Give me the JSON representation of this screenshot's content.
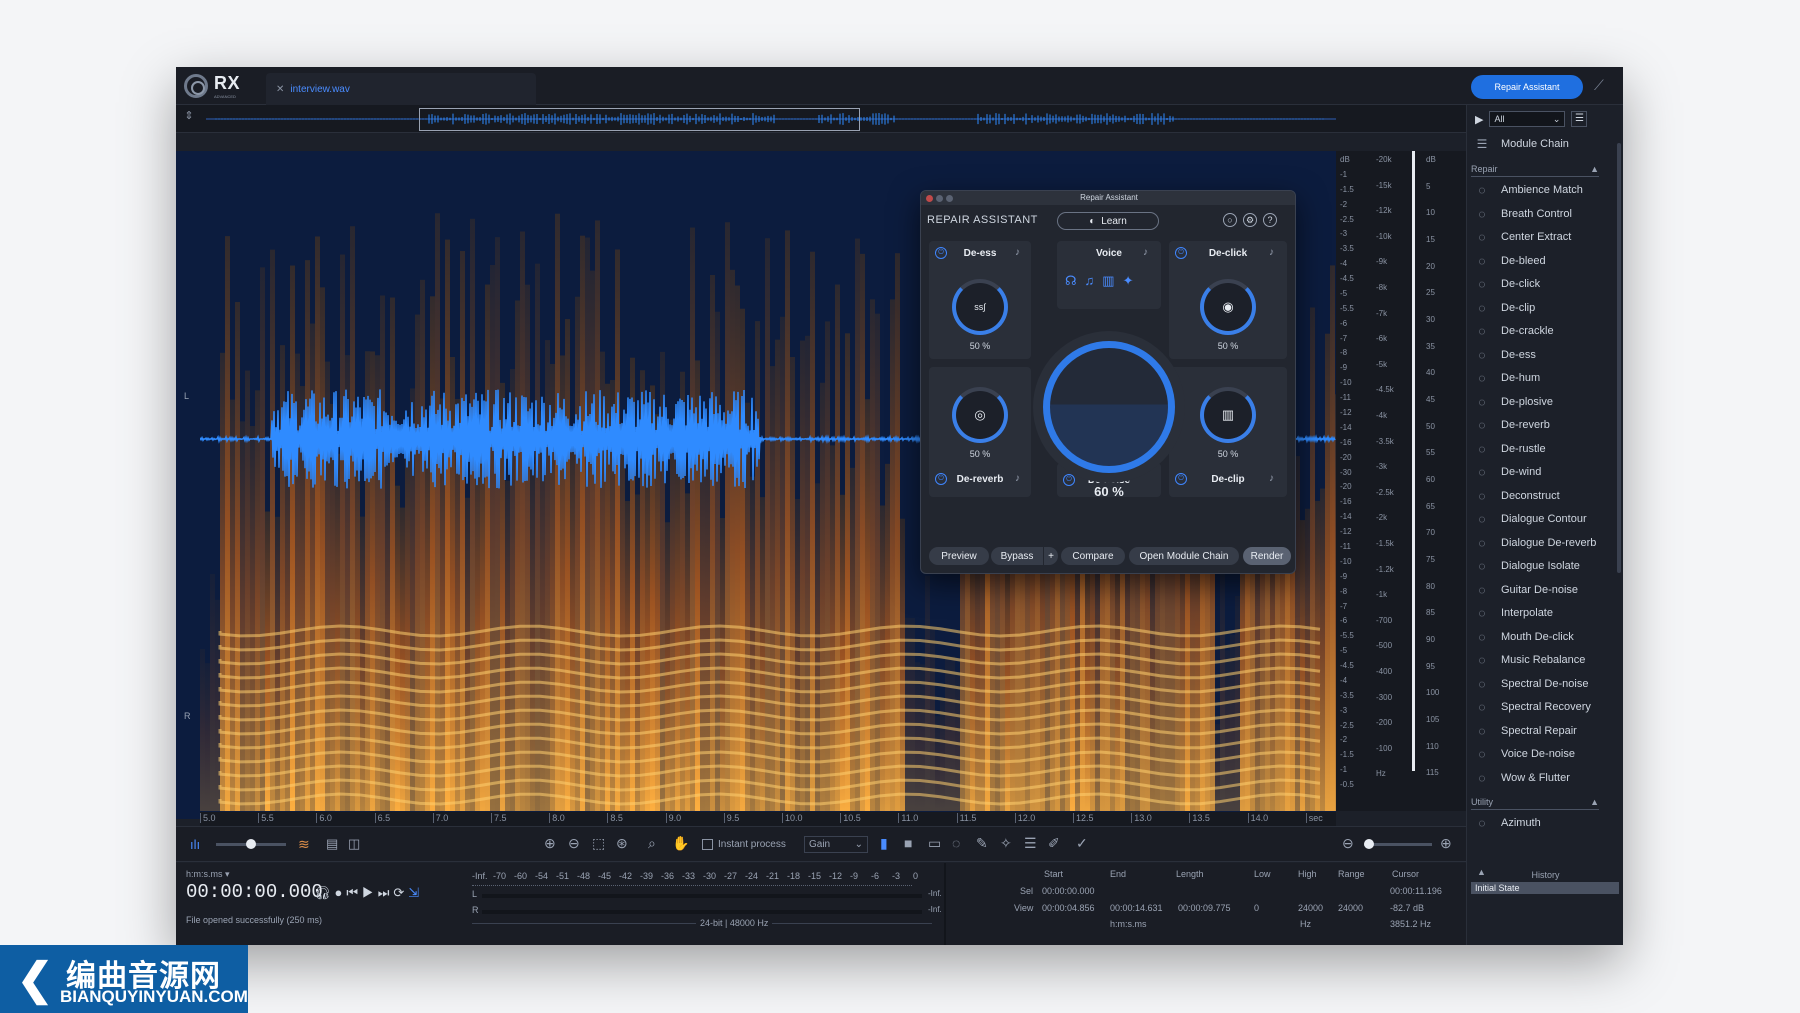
{
  "app": {
    "logo": "RX",
    "logo_sub": "ADVANCED",
    "file_tab": "interview.wav",
    "repair_assistant_button": "Repair Assistant"
  },
  "spectrogram": {
    "channel_left": "L",
    "channel_right": "R",
    "time_ticks": [
      "5.0",
      "5.5",
      "6.0",
      "6.5",
      "7.0",
      "7.5",
      "8.0",
      "8.5",
      "9.0",
      "9.5",
      "10.0",
      "10.5",
      "11.0",
      "11.5",
      "12.0",
      "12.5",
      "13.0",
      "13.5",
      "14.0",
      "sec"
    ],
    "amp_ticks": [
      "dB",
      "-1",
      "-1.5",
      "-2",
      "-2.5",
      "-3",
      "-3.5",
      "-4",
      "-4.5",
      "-5",
      "-5.5",
      "-6",
      "-7",
      "-8",
      "-9",
      "-10",
      "-11",
      "-12",
      "-14",
      "-16",
      "-20",
      "-30",
      "-20",
      "-16",
      "-14",
      "-12",
      "-11",
      "-10",
      "-9",
      "-8",
      "-7",
      "-6",
      "-5.5",
      "-5",
      "-4.5",
      "-4",
      "-3.5",
      "-3",
      "-2.5",
      "-2",
      "-1.5",
      "-1",
      "-0.5"
    ],
    "hz_ticks": [
      "-20k",
      "-15k",
      "-12k",
      "-10k",
      "-9k",
      "-8k",
      "-7k",
      "-6k",
      "-5k",
      "-4.5k",
      "-4k",
      "-3.5k",
      "-3k",
      "-2.5k",
      "-2k",
      "-1.5k",
      "-1.2k",
      "-1k",
      "-700",
      "-500",
      "-400",
      "-300",
      "-200",
      "-100",
      "Hz"
    ],
    "meter_ticks": [
      "dB",
      "5",
      "10",
      "15",
      "20",
      "25",
      "30",
      "35",
      "40",
      "45",
      "50",
      "55",
      "60",
      "65",
      "70",
      "75",
      "80",
      "85",
      "90",
      "95",
      "100",
      "105",
      "110",
      "115"
    ]
  },
  "toolbar": {
    "instant_process": "Instant process",
    "gain": "Gain"
  },
  "status": {
    "time_format": "h:m:s.ms",
    "timecode": "00:00:00.000",
    "message": "File opened successfully (250 ms)",
    "meter_scale": [
      "-Inf.",
      "-70",
      "-60",
      "-54",
      "-51",
      "-48",
      "-45",
      "-42",
      "-39",
      "-36",
      "-33",
      "-30",
      "-27",
      "-24",
      "-21",
      "-18",
      "-15",
      "-12",
      "-9",
      "-6",
      "-3",
      "0"
    ],
    "meter_L": "L",
    "meter_R": "R",
    "meter_inf_L": "-Inf.",
    "meter_inf_R": "-Inf.",
    "format": "24-bit | 48000 Hz",
    "headers": {
      "start": "Start",
      "end": "End",
      "length": "Length",
      "low": "Low",
      "high": "High",
      "range": "Range",
      "cursor": "Cursor"
    },
    "sel_label": "Sel",
    "view_label": "View",
    "sel_start": "00:00:00.000",
    "view_start": "00:00:04.856",
    "view_end": "00:00:14.631",
    "view_length": "00:00:09.775",
    "low": "0",
    "high": "24000",
    "range": "24000",
    "cursor_time": "00:00:11.196",
    "cursor_db": "-82.7 dB",
    "cursor_hz": "3851.2 Hz",
    "unit_time": "h:m:s.ms",
    "unit_hz": "Hz"
  },
  "modules": {
    "filter": "All",
    "module_chain": "Module Chain",
    "repair_header": "Repair",
    "repair": [
      {
        "label": "Ambience Match",
        "icon": "ambience-icon"
      },
      {
        "label": "Breath Control",
        "icon": "breath-icon"
      },
      {
        "label": "Center Extract",
        "icon": "center-icon"
      },
      {
        "label": "De-bleed",
        "icon": "debleed-icon"
      },
      {
        "label": "De-click",
        "icon": "declick-icon"
      },
      {
        "label": "De-clip",
        "icon": "declip-icon"
      },
      {
        "label": "De-crackle",
        "icon": "decrackle-icon"
      },
      {
        "label": "De-ess",
        "icon": "deess-icon"
      },
      {
        "label": "De-hum",
        "icon": "dehum-icon"
      },
      {
        "label": "De-plosive",
        "icon": "deplosive-icon"
      },
      {
        "label": "De-reverb",
        "icon": "dereverb-icon"
      },
      {
        "label": "De-rustle",
        "icon": "derustle-icon"
      },
      {
        "label": "De-wind",
        "icon": "dewind-icon"
      },
      {
        "label": "Deconstruct",
        "icon": "deconstruct-icon"
      },
      {
        "label": "Dialogue Contour",
        "icon": "contour-icon"
      },
      {
        "label": "Dialogue De-reverb",
        "icon": "dialogue-dereverb-icon"
      },
      {
        "label": "Dialogue Isolate",
        "icon": "isolate-icon"
      },
      {
        "label": "Guitar De-noise",
        "icon": "guitar-icon"
      },
      {
        "label": "Interpolate",
        "icon": "interpolate-icon"
      },
      {
        "label": "Mouth De-click",
        "icon": "mouth-icon"
      },
      {
        "label": "Music Rebalance",
        "icon": "music-icon"
      },
      {
        "label": "Spectral De-noise",
        "icon": "spectral-denoise-icon"
      },
      {
        "label": "Spectral Recovery",
        "icon": "spectral-recovery-icon"
      },
      {
        "label": "Spectral Repair",
        "icon": "spectral-repair-icon"
      },
      {
        "label": "Voice De-noise",
        "icon": "voice-icon"
      },
      {
        "label": "Wow & Flutter",
        "icon": "wow-icon"
      }
    ],
    "utility_header": "Utility",
    "utility": [
      {
        "label": "Azimuth",
        "icon": "azimuth-icon"
      }
    ]
  },
  "history": {
    "title": "History",
    "item": "Initial State"
  },
  "repair_assistant": {
    "window_title": "Repair Assistant",
    "header": "REPAIR ASSISTANT",
    "learn": "Learn",
    "center_label": "Voice",
    "center_value": "60 %",
    "center_level": 0.6,
    "cards": [
      {
        "label": "De-ess",
        "value": "50 %"
      },
      {
        "label": "De-click",
        "value": "50 %"
      },
      {
        "label": "De-reverb",
        "value": "50 %"
      },
      {
        "label": "De-noise",
        "value": ""
      },
      {
        "label": "De-clip",
        "value": "50 %"
      }
    ],
    "footer": {
      "preview": "Preview",
      "bypass": "Bypass",
      "plus": "+",
      "compare": "Compare",
      "open_chain": "Open Module Chain",
      "render": "Render"
    }
  },
  "watermark": {
    "cn": "编曲音源网",
    "en": "BIANQUYINYUAN.COM"
  },
  "colors": {
    "accent": "#1f6fe0",
    "spectrogram_low": "#0c1c3e",
    "spectrogram_high": "#f08a1c",
    "waveform": "#2f8bff"
  }
}
